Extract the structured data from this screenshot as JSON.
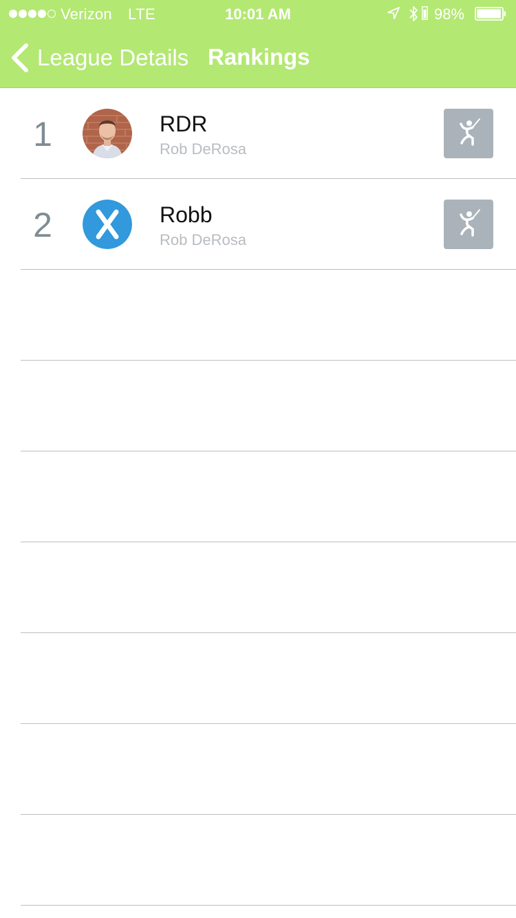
{
  "status_bar": {
    "carrier": "Verizon",
    "network": "LTE",
    "time": "10:01 AM",
    "battery_percent": "98%",
    "signal_bars_filled": 4,
    "signal_bars_total": 5,
    "battery_level": 0.98
  },
  "nav": {
    "back_label": "League Details",
    "title": "Rankings"
  },
  "colors": {
    "header_bg": "#b3e873",
    "rank_text": "#7f8c93",
    "action_button_bg": "#aab3ba",
    "avatar_blue": "#3199dc"
  },
  "rankings": [
    {
      "rank": "1",
      "name": "RDR",
      "full_name": "Rob DeRosa",
      "avatar": "photo-avatar",
      "action_icon": "player-swing-icon"
    },
    {
      "rank": "2",
      "name": "Robb",
      "full_name": "Rob DeRosa",
      "avatar": "x-logo-avatar",
      "action_icon": "player-swing-icon"
    }
  ]
}
